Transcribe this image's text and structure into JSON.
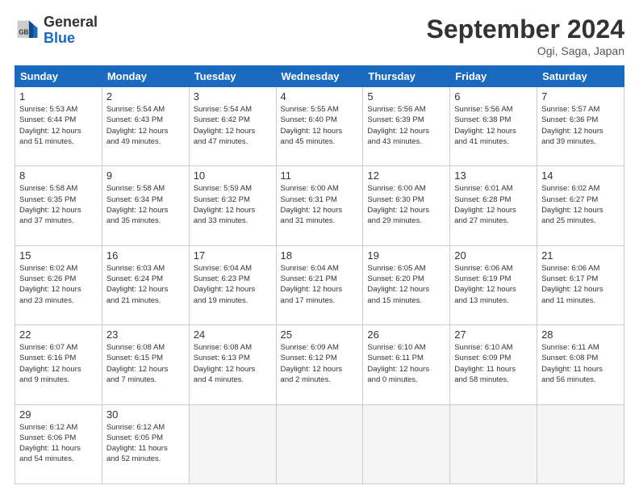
{
  "header": {
    "logo_general": "General",
    "logo_blue": "Blue",
    "title": "September 2024",
    "location": "Ogi, Saga, Japan"
  },
  "weekdays": [
    "Sunday",
    "Monday",
    "Tuesday",
    "Wednesday",
    "Thursday",
    "Friday",
    "Saturday"
  ],
  "weeks": [
    [
      {
        "day": "1",
        "info": "Sunrise: 5:53 AM\nSunset: 6:44 PM\nDaylight: 12 hours\nand 51 minutes."
      },
      {
        "day": "2",
        "info": "Sunrise: 5:54 AM\nSunset: 6:43 PM\nDaylight: 12 hours\nand 49 minutes."
      },
      {
        "day": "3",
        "info": "Sunrise: 5:54 AM\nSunset: 6:42 PM\nDaylight: 12 hours\nand 47 minutes."
      },
      {
        "day": "4",
        "info": "Sunrise: 5:55 AM\nSunset: 6:40 PM\nDaylight: 12 hours\nand 45 minutes."
      },
      {
        "day": "5",
        "info": "Sunrise: 5:56 AM\nSunset: 6:39 PM\nDaylight: 12 hours\nand 43 minutes."
      },
      {
        "day": "6",
        "info": "Sunrise: 5:56 AM\nSunset: 6:38 PM\nDaylight: 12 hours\nand 41 minutes."
      },
      {
        "day": "7",
        "info": "Sunrise: 5:57 AM\nSunset: 6:36 PM\nDaylight: 12 hours\nand 39 minutes."
      }
    ],
    [
      {
        "day": "8",
        "info": "Sunrise: 5:58 AM\nSunset: 6:35 PM\nDaylight: 12 hours\nand 37 minutes."
      },
      {
        "day": "9",
        "info": "Sunrise: 5:58 AM\nSunset: 6:34 PM\nDaylight: 12 hours\nand 35 minutes."
      },
      {
        "day": "10",
        "info": "Sunrise: 5:59 AM\nSunset: 6:32 PM\nDaylight: 12 hours\nand 33 minutes."
      },
      {
        "day": "11",
        "info": "Sunrise: 6:00 AM\nSunset: 6:31 PM\nDaylight: 12 hours\nand 31 minutes."
      },
      {
        "day": "12",
        "info": "Sunrise: 6:00 AM\nSunset: 6:30 PM\nDaylight: 12 hours\nand 29 minutes."
      },
      {
        "day": "13",
        "info": "Sunrise: 6:01 AM\nSunset: 6:28 PM\nDaylight: 12 hours\nand 27 minutes."
      },
      {
        "day": "14",
        "info": "Sunrise: 6:02 AM\nSunset: 6:27 PM\nDaylight: 12 hours\nand 25 minutes."
      }
    ],
    [
      {
        "day": "15",
        "info": "Sunrise: 6:02 AM\nSunset: 6:26 PM\nDaylight: 12 hours\nand 23 minutes."
      },
      {
        "day": "16",
        "info": "Sunrise: 6:03 AM\nSunset: 6:24 PM\nDaylight: 12 hours\nand 21 minutes."
      },
      {
        "day": "17",
        "info": "Sunrise: 6:04 AM\nSunset: 6:23 PM\nDaylight: 12 hours\nand 19 minutes."
      },
      {
        "day": "18",
        "info": "Sunrise: 6:04 AM\nSunset: 6:21 PM\nDaylight: 12 hours\nand 17 minutes."
      },
      {
        "day": "19",
        "info": "Sunrise: 6:05 AM\nSunset: 6:20 PM\nDaylight: 12 hours\nand 15 minutes."
      },
      {
        "day": "20",
        "info": "Sunrise: 6:06 AM\nSunset: 6:19 PM\nDaylight: 12 hours\nand 13 minutes."
      },
      {
        "day": "21",
        "info": "Sunrise: 6:06 AM\nSunset: 6:17 PM\nDaylight: 12 hours\nand 11 minutes."
      }
    ],
    [
      {
        "day": "22",
        "info": "Sunrise: 6:07 AM\nSunset: 6:16 PM\nDaylight: 12 hours\nand 9 minutes."
      },
      {
        "day": "23",
        "info": "Sunrise: 6:08 AM\nSunset: 6:15 PM\nDaylight: 12 hours\nand 7 minutes."
      },
      {
        "day": "24",
        "info": "Sunrise: 6:08 AM\nSunset: 6:13 PM\nDaylight: 12 hours\nand 4 minutes."
      },
      {
        "day": "25",
        "info": "Sunrise: 6:09 AM\nSunset: 6:12 PM\nDaylight: 12 hours\nand 2 minutes."
      },
      {
        "day": "26",
        "info": "Sunrise: 6:10 AM\nSunset: 6:11 PM\nDaylight: 12 hours\nand 0 minutes."
      },
      {
        "day": "27",
        "info": "Sunrise: 6:10 AM\nSunset: 6:09 PM\nDaylight: 11 hours\nand 58 minutes."
      },
      {
        "day": "28",
        "info": "Sunrise: 6:11 AM\nSunset: 6:08 PM\nDaylight: 11 hours\nand 56 minutes."
      }
    ],
    [
      {
        "day": "29",
        "info": "Sunrise: 6:12 AM\nSunset: 6:06 PM\nDaylight: 11 hours\nand 54 minutes."
      },
      {
        "day": "30",
        "info": "Sunrise: 6:12 AM\nSunset: 6:05 PM\nDaylight: 11 hours\nand 52 minutes."
      },
      {
        "day": "",
        "info": ""
      },
      {
        "day": "",
        "info": ""
      },
      {
        "day": "",
        "info": ""
      },
      {
        "day": "",
        "info": ""
      },
      {
        "day": "",
        "info": ""
      }
    ]
  ]
}
